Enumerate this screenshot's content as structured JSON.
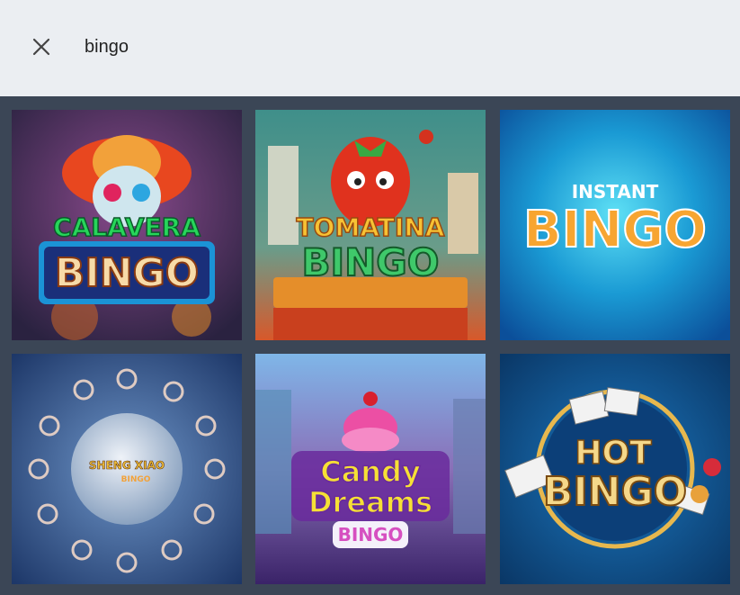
{
  "search": {
    "query": "bingo",
    "close_icon": "close-icon"
  },
  "results": [
    {
      "title_line1": "CALAVERA",
      "title_line2": "BINGO",
      "colors": {
        "bg": "#3a2a52",
        "accent": "#e8471f"
      }
    },
    {
      "title_line1": "TOMATINA",
      "title_line2": "BINGO",
      "colors": {
        "bg": "#2f6a6e",
        "accent": "#e8381f"
      }
    },
    {
      "title_line1": "INSTANT",
      "title_line2": "BINGO",
      "colors": {
        "bg": "#1690c8",
        "accent": "#f04b4b"
      }
    },
    {
      "title_line1": "SHENG XIAO",
      "title_line2": "BINGO",
      "colors": {
        "bg": "#2c4f86",
        "accent": "#f2c23a"
      }
    },
    {
      "title_line1": "Candy",
      "title_line2": "Dreams",
      "title_line3": "BINGO",
      "colors": {
        "bg": "#5a3d8c",
        "accent": "#f6e035"
      }
    },
    {
      "title_line1": "HOT",
      "title_line2": "BINGO",
      "colors": {
        "bg": "#0e4f86",
        "accent": "#f0c35a"
      }
    }
  ]
}
